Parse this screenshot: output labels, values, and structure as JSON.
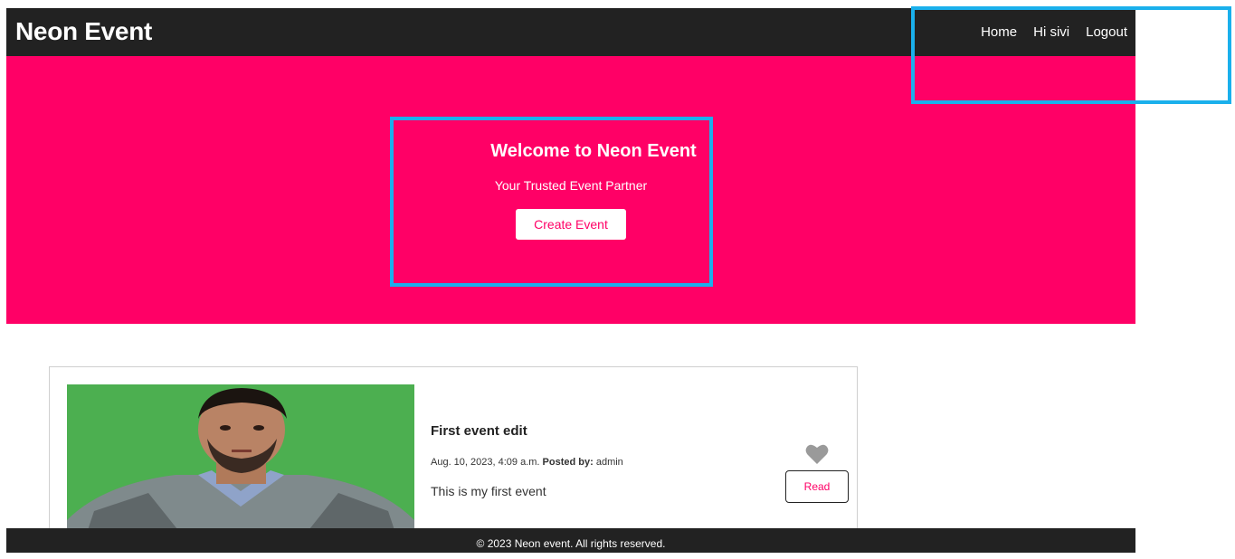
{
  "navbar": {
    "brand": "Neon Event",
    "links": [
      "Home",
      "Hi sivi",
      "Logout"
    ]
  },
  "hero": {
    "title": "Welcome to Neon Event",
    "subtitle": "Your Trusted Event Partner",
    "button_label": "Create Event"
  },
  "events": [
    {
      "title": "First event edit",
      "date": "Aug. 10, 2023, 4:09 a.m.",
      "posted_by_label": "Posted by:",
      "author": "admin",
      "description": "This is my first event",
      "read_label": "Read",
      "like_icon": "heart-icon"
    }
  ],
  "footer": {
    "text": "© 2023 Neon event. All rights reserved."
  },
  "colors": {
    "navbar_bg": "#222222",
    "hero_bg": "#ff0066",
    "accent": "#ff0066",
    "highlight": "#1ab0ec",
    "image_bg": "#4caf50"
  }
}
